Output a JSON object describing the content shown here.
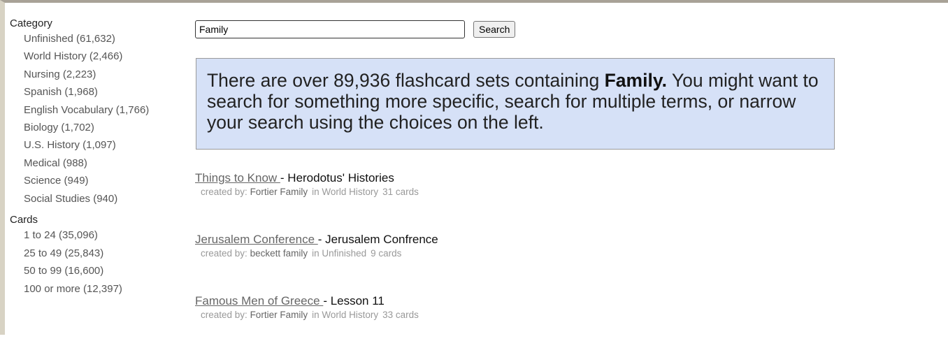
{
  "sidebar": {
    "category_heading": "Category",
    "categories": [
      "Unfinished (61,632)",
      "World History (2,466)",
      "Nursing (2,223)",
      "Spanish (1,968)",
      "English Vocabulary (1,766)",
      "Biology (1,702)",
      "U.S. History (1,097)",
      "Medical (988)",
      "Science (949)",
      "Social Studies (940)"
    ],
    "cards_heading": "Cards",
    "cards": [
      "1 to 24 (35,096)",
      "25 to 49 (25,843)",
      "50 to 99 (16,600)",
      "100 or more (12,397)"
    ]
  },
  "search": {
    "value": "Family",
    "button_label": "Search"
  },
  "notice": {
    "prefix": "There are over 89,936 flashcard sets containing ",
    "term": "Family.",
    "suffix": " You might want to search for something more specific, search for multiple terms, or narrow your search using the choices on the left."
  },
  "results": [
    {
      "link": "Things to Know ",
      "subtitle": "- Herodotus' Histories",
      "created_by_label": "created by:",
      "creator": "Fortier Family",
      "category": "in World History",
      "cards": "31 cards"
    },
    {
      "link": "Jerusalem Conference ",
      "subtitle": "- Jerusalem Confrence",
      "created_by_label": "created by:",
      "creator": "beckett family",
      "category": "in Unfinished",
      "cards": "9 cards"
    },
    {
      "link": "Famous Men of Greece ",
      "subtitle": "- Lesson 11",
      "created_by_label": "created by:",
      "creator": "Fortier Family",
      "category": "in World History",
      "cards": "33 cards"
    }
  ]
}
